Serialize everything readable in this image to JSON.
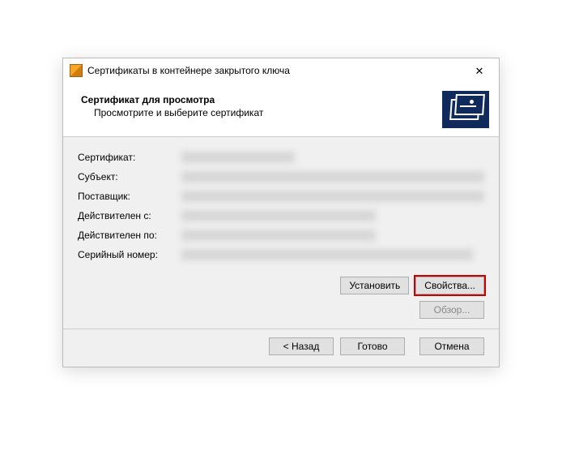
{
  "titlebar": {
    "text": "Сертификаты в контейнере закрытого ключа"
  },
  "header": {
    "title": "Сертификат для просмотра",
    "subtitle": "Просмотрите и выберите сертификат"
  },
  "fields": {
    "cert_label": "Сертификат:",
    "subject_label": "Субъект:",
    "issuer_label": "Поставщик:",
    "valid_from_label": "Действителен с:",
    "valid_to_label": "Действителен по:",
    "serial_label": "Серийный номер:"
  },
  "buttons": {
    "install": "Установить",
    "properties": "Свойства...",
    "browse": "Обзор...",
    "back": "< Назад",
    "finish": "Готово",
    "cancel": "Отмена"
  }
}
